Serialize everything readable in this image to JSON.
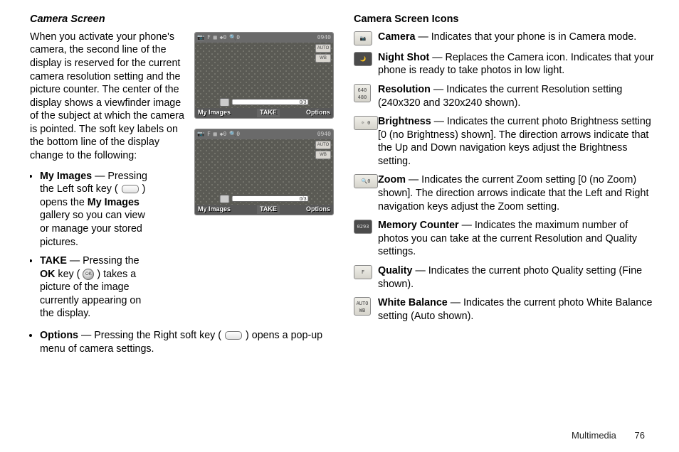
{
  "left": {
    "heading": "Camera Screen",
    "intro": "When you activate your phone's camera, the second line of the display is reserved for the current camera resolution setting and the picture counter. The center of the display shows a viewfinder image of the subject at which the camera is pointed. The soft key labels on the bottom line of the display change to the following:",
    "status_counter": "0940",
    "badge_auto": "AUTO",
    "badge_wb": "WB",
    "progress_label": "0/3",
    "softkeys": {
      "left": "My Images",
      "center": "TAKE",
      "right": "Options"
    },
    "bullets": {
      "myimages_label": "My Images",
      "myimages_text1": " — Pressing the Left soft key ( ",
      "myimages_text2": " ) opens the ",
      "myimages_bold2": "My Images",
      "myimages_text3": " gallery so you can view or manage your stored pictures.",
      "take_label": "TAKE",
      "take_text1": " — Pressing the ",
      "take_bold2": "OK",
      "take_text2": " key ( ",
      "take_text3": " ) takes a picture of the image currently appearing on the display.",
      "options_label": "Options",
      "options_text1": " — Pressing the Right soft key ( ",
      "options_text2": " ) opens a pop-up menu of camera settings."
    }
  },
  "right": {
    "heading": "Camera Screen Icons",
    "items": [
      {
        "term": "Camera",
        "desc": " — Indicates that your phone is in Camera mode."
      },
      {
        "term": "Night Shot",
        "desc": " — Replaces the Camera icon. Indicates that your phone is ready to take photos in low light."
      },
      {
        "term": "Resolution",
        "desc": " — Indicates the current Resolution setting (240x320 and 320x240 shown)."
      },
      {
        "term": "Brightness",
        "desc": " — Indicates the current photo Brightness setting [0 (no Brightness) shown]. The direction arrows indicate that the Up and Down navigation keys adjust the Brightness setting."
      },
      {
        "term": "Zoom",
        "desc": " — Indicates the current Zoom setting [0 (no Zoom) shown]. The direction arrows indicate that the Left and Right navigation keys adjust the Zoom setting."
      },
      {
        "term": "Memory Counter",
        "desc": " — Indicates the maximum number of photos you can take at the current Resolution and Quality settings."
      },
      {
        "term": "Quality",
        "desc": " — Indicates the current photo Quality setting (Fine shown)."
      },
      {
        "term": "White Balance",
        "desc": " — Indicates the current photo White Balance setting (Auto shown)."
      }
    ],
    "icon_labels": {
      "camera": "📷",
      "night": "🌙",
      "res1": "640",
      "res2": "480",
      "bright": "☼ 0",
      "zoom": "🔍0",
      "mem": "0293",
      "quality": "F",
      "wb1": "AUTO",
      "wb2": "WB"
    }
  },
  "footer": {
    "section": "Multimedia",
    "page": "76"
  }
}
